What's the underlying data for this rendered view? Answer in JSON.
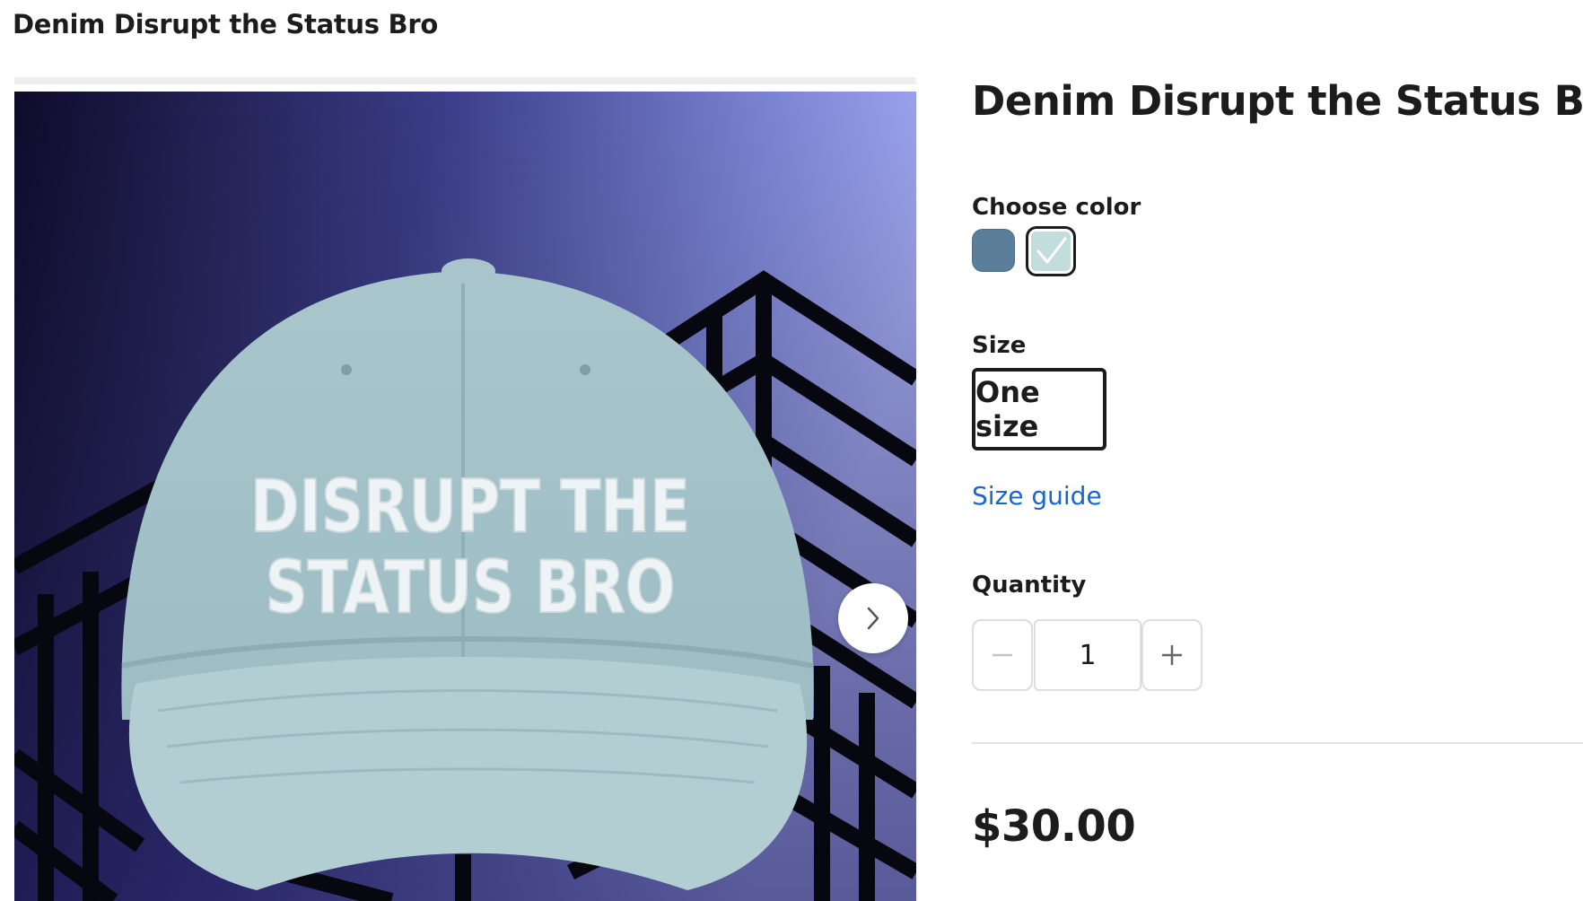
{
  "header": {
    "title": "Denim Disrupt the Status Bro"
  },
  "product": {
    "title": "Denim Disrupt the Status Bro",
    "image_text": [
      "DISRUPT THE",
      "STATUS BRO"
    ],
    "price": "$30.00"
  },
  "color": {
    "label": "Choose color",
    "options": [
      {
        "hex": "#5b7f9b",
        "selected": false
      },
      {
        "hex": "#c3dcdc",
        "selected": true
      }
    ]
  },
  "size": {
    "label": "Size",
    "options": [
      "One size"
    ],
    "selected": "One size",
    "guide_link": "Size guide"
  },
  "quantity": {
    "label": "Quantity",
    "value": "1"
  },
  "colors": {
    "accent_link": "#1a66c9",
    "text": "#1c1c1c"
  },
  "icons": [
    "chevron-right-icon",
    "check-icon",
    "minus-icon",
    "plus-icon"
  ]
}
